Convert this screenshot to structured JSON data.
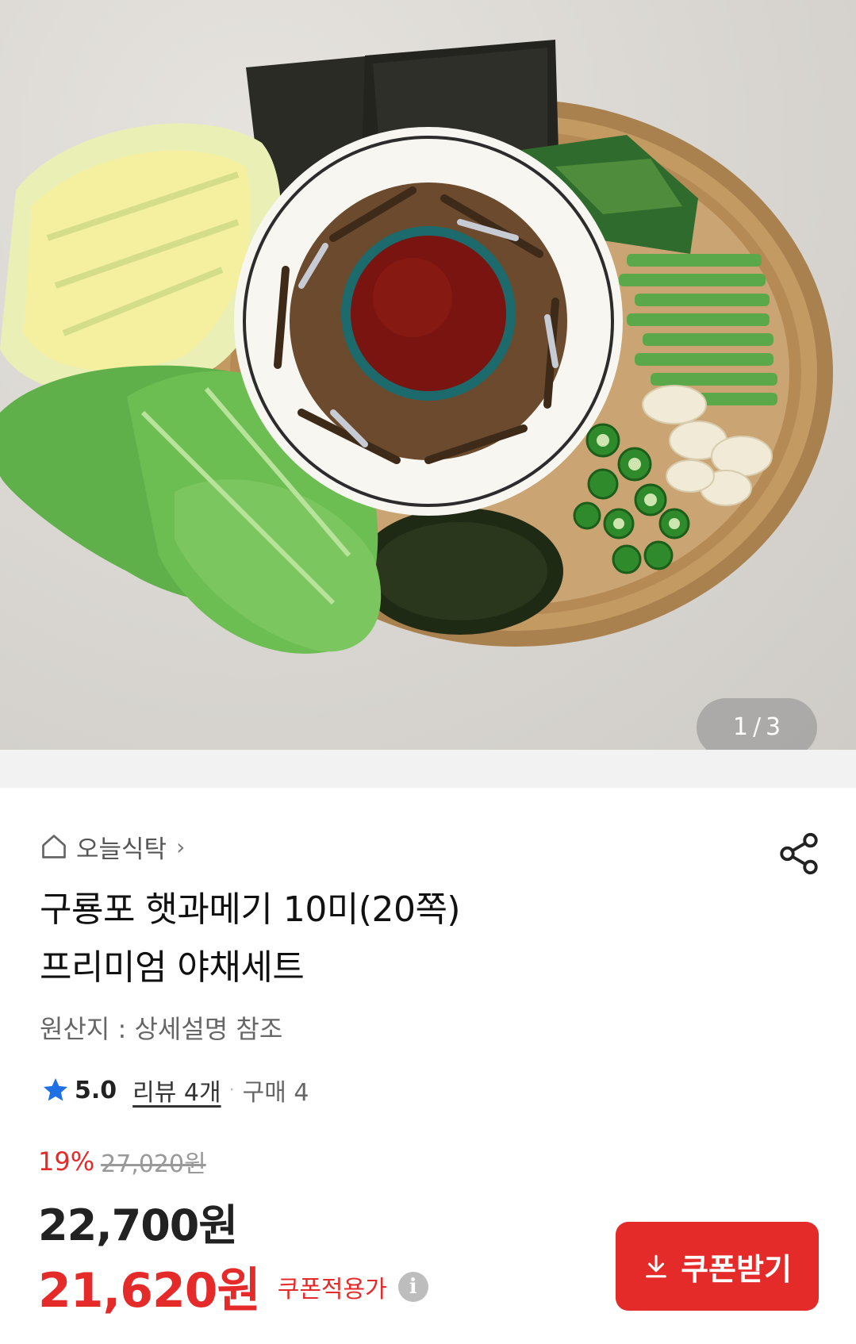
{
  "carousel": {
    "current": "1",
    "total": "3",
    "separator": "/"
  },
  "store": {
    "name": "오늘식탁",
    "chevron": "›",
    "icon": "home-icon"
  },
  "share": {
    "icon": "share-icon"
  },
  "product": {
    "title_line1": "구룡포 햇과메기 10미(20쪽)",
    "title_line2": "프리미엄 야채세트",
    "origin": "원산지 : 상세설명 참조"
  },
  "rating": {
    "icon": "star-icon",
    "score": "5.0",
    "review": "리뷰 4개",
    "dot": "·",
    "purchase": "구매 4"
  },
  "pricing": {
    "discount_percent": "19%",
    "original_price": "27,020원",
    "price": "22,700원",
    "coupon_price": "21,620원",
    "coupon_label": "쿠폰적용가",
    "info_icon": "i"
  },
  "coupon_button": {
    "label": "쿠폰받기",
    "icon": "download-icon"
  },
  "colors": {
    "accent": "#e52a2a",
    "star": "#1f6fe5"
  }
}
